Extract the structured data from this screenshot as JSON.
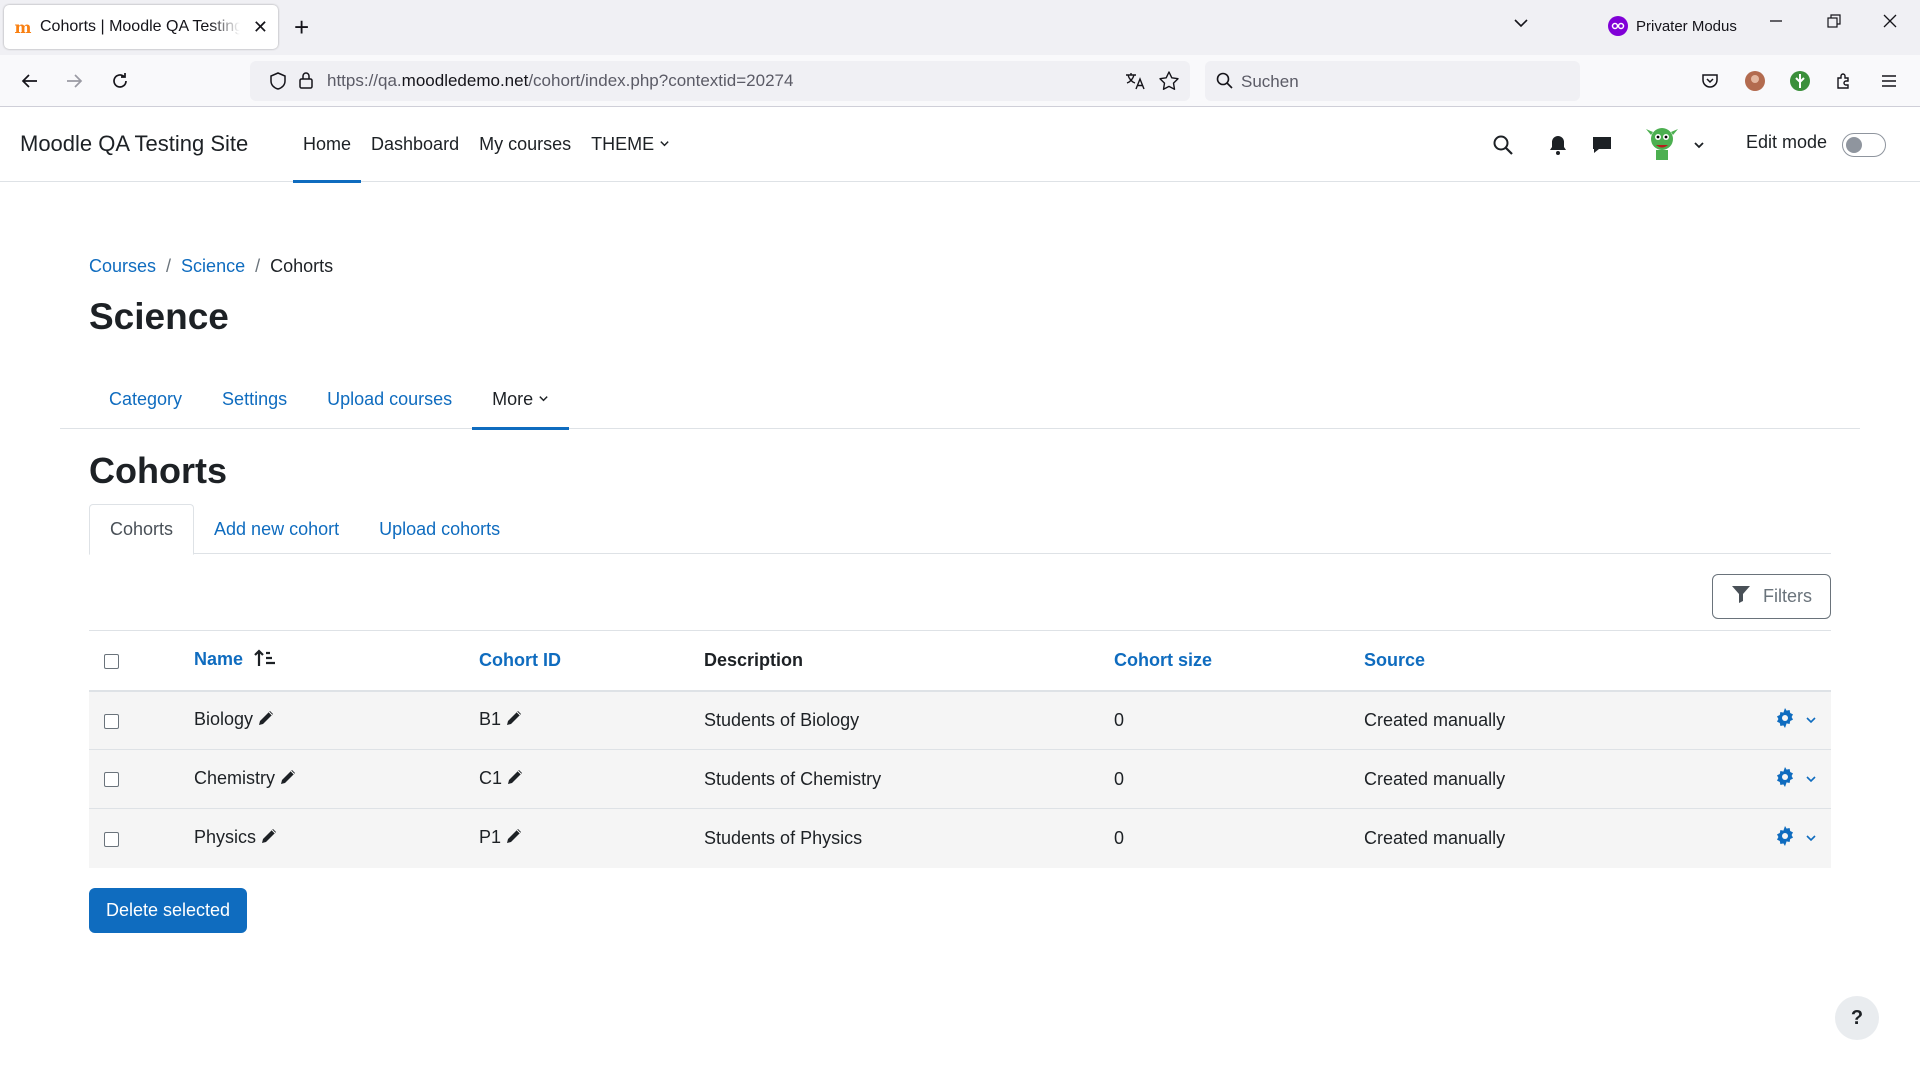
{
  "browser": {
    "tab_title": "Cohorts | Moodle QA Testing Site",
    "private_label": "Privater Modus",
    "url_prefix": "https://qa.",
    "url_domain": "moodledemo.net",
    "url_path": "/cohort/index.php?contextid=20274",
    "search_placeholder": "Suchen"
  },
  "site": {
    "brand": "Moodle QA Testing Site",
    "nav": [
      {
        "label": "Home"
      },
      {
        "label": "Dashboard"
      },
      {
        "label": "My courses"
      },
      {
        "label": "THEME"
      }
    ],
    "edit_mode_label": "Edit mode"
  },
  "breadcrumb": [
    {
      "label": "Courses"
    },
    {
      "label": "Science"
    },
    {
      "label": "Cohorts"
    }
  ],
  "page_title": "Science",
  "secondary_nav": [
    {
      "label": "Category"
    },
    {
      "label": "Settings"
    },
    {
      "label": "Upload courses"
    },
    {
      "label": "More"
    }
  ],
  "section_heading": "Cohorts",
  "tabs": [
    {
      "label": "Cohorts"
    },
    {
      "label": "Add new cohort"
    },
    {
      "label": "Upload cohorts"
    }
  ],
  "filters_label": "Filters",
  "table": {
    "headers": {
      "name": "Name",
      "cohort_id": "Cohort ID",
      "description": "Description",
      "size": "Cohort size",
      "source": "Source"
    },
    "rows": [
      {
        "name": "Biology",
        "cohort_id": "B1",
        "description": "Students of Biology",
        "size": "0",
        "source": "Created manually"
      },
      {
        "name": "Chemistry",
        "cohort_id": "C1",
        "description": "Students of Chemistry",
        "size": "0",
        "source": "Created manually"
      },
      {
        "name": "Physics",
        "cohort_id": "P1",
        "description": "Students of Physics",
        "size": "0",
        "source": "Created manually"
      }
    ]
  },
  "delete_label": "Delete selected",
  "help_label": "?",
  "colors": {
    "primary": "#0f6cbf",
    "text": "#1d2125",
    "row_bg": "#f5f5f5"
  }
}
